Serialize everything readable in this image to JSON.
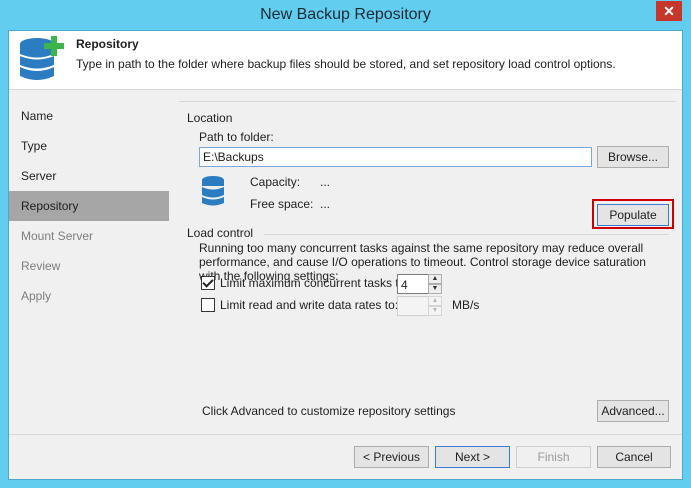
{
  "window": {
    "title": "New Backup Repository",
    "close_glyph": "✕"
  },
  "header": {
    "title": "Repository",
    "description": "Type in path to the folder where backup files should be stored, and set repository load control options.",
    "icon": "database-add-icon"
  },
  "sidebar": {
    "items": [
      {
        "label": "Name",
        "state": "normal"
      },
      {
        "label": "Type",
        "state": "normal"
      },
      {
        "label": "Server",
        "state": "normal"
      },
      {
        "label": "Repository",
        "state": "active"
      },
      {
        "label": "Mount Server",
        "state": "disabled"
      },
      {
        "label": "Review",
        "state": "disabled"
      },
      {
        "label": "Apply",
        "state": "disabled"
      }
    ]
  },
  "location": {
    "section_label": "Location",
    "path_label": "Path to folder:",
    "path_value": "E:\\Backups",
    "browse_label": "Browse...",
    "populate_label": "Populate",
    "capacity_label": "Capacity:",
    "capacity_value": "...",
    "free_space_label": "Free space:",
    "free_space_value": "..."
  },
  "load_control": {
    "section_label": "Load control",
    "description": "Running too many concurrent tasks against the same repository may reduce overall performance, and cause I/O operations to timeout. Control storage device saturation with the following settings:",
    "limit_tasks_label": "Limit maximum concurrent tasks to:",
    "limit_tasks_checked": true,
    "limit_tasks_value": "4",
    "limit_rate_label": "Limit read and write data rates to:",
    "limit_rate_checked": false,
    "limit_rate_value": "",
    "limit_rate_unit": "MB/s"
  },
  "advanced": {
    "hint": "Click Advanced to customize repository settings",
    "button_label": "Advanced..."
  },
  "footer": {
    "previous_label": "< Previous",
    "next_label": "Next >",
    "finish_label": "Finish",
    "cancel_label": "Cancel"
  },
  "colors": {
    "title_bar": "#63cdf0",
    "active_item": "#a6a6a6",
    "highlight": "#d00000",
    "plus_green": "#3cb54a",
    "db_blue": "#2b7cc1"
  }
}
